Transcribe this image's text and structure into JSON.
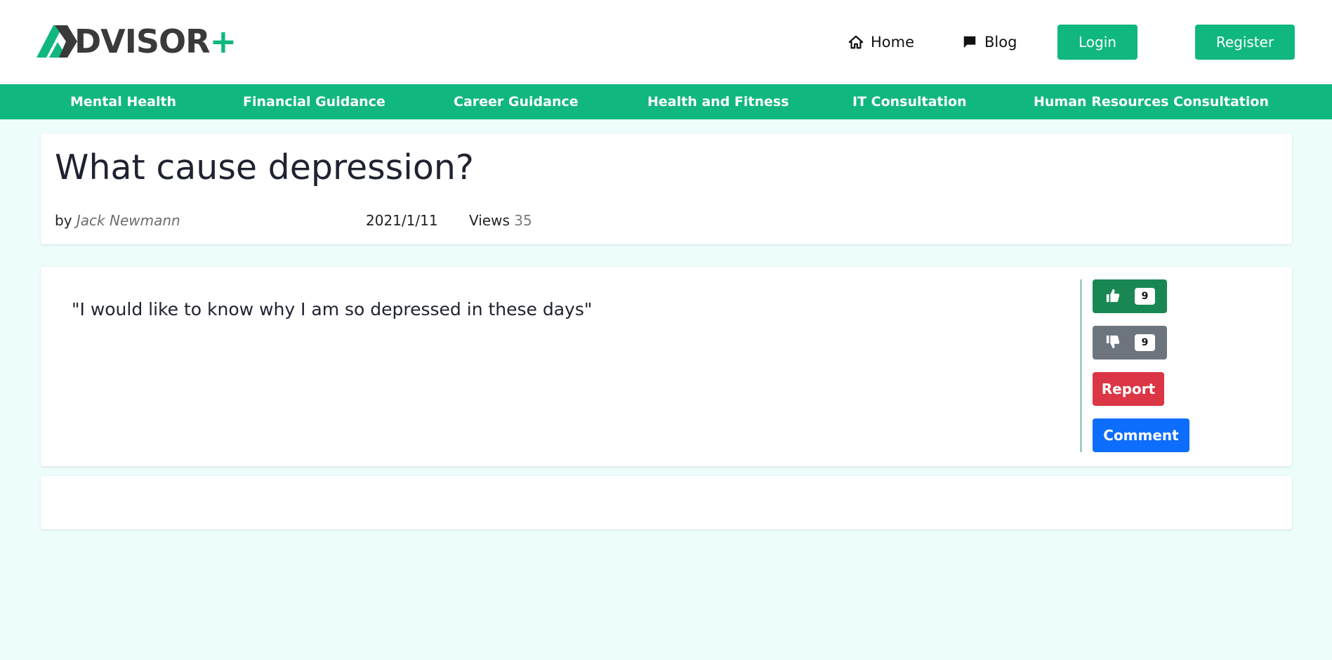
{
  "header": {
    "logo_text": "DVISOR",
    "logo_plus": "+",
    "nav": {
      "home_label": "Home",
      "home_icon": "home-icon",
      "blog_label": "Blog",
      "blog_icon": "comment-icon"
    },
    "login_label": "Login",
    "register_label": "Register"
  },
  "categories": [
    "Mental Health",
    "Financial Guidance",
    "Career Guidance",
    "Health and Fitness",
    "IT Consultation",
    "Human Resources Consultation"
  ],
  "post": {
    "title": "What cause depression?",
    "by_label": "by",
    "author": "Jack Newmann",
    "date": "2021/1/11",
    "views_label": "Views",
    "views_count": "35",
    "question": "\"I would like to know why I am so depressed in these days\"",
    "likes": "9",
    "dislikes": "9",
    "like_icon": "thumbs-up-icon",
    "dislike_icon": "thumbs-down-icon",
    "report_label": "Report",
    "comment_label": "Comment"
  },
  "colors": {
    "brand_green": "#10b77f",
    "like_green": "#198754",
    "dislike_gray": "#6c757d",
    "report_red": "#dc3545",
    "comment_blue": "#0d6efd",
    "page_bg": "#edfdfb"
  }
}
